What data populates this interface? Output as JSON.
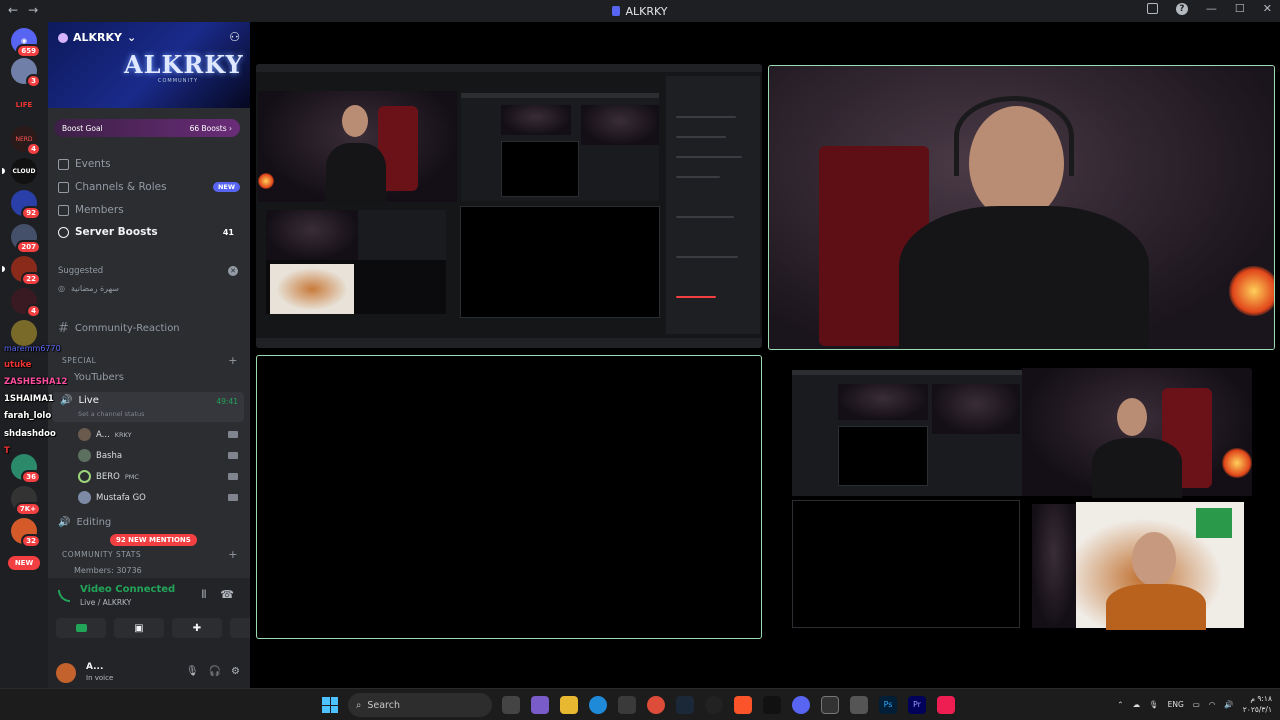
{
  "window": {
    "title": "ALKRKY"
  },
  "servers": [
    {
      "name": "discord-home",
      "badge": "659"
    },
    {
      "name": "server-2",
      "badge": "3"
    },
    {
      "name": "server-life",
      "label": "LIFE",
      "badge": ""
    },
    {
      "name": "server-4",
      "label": "NERD",
      "badge": "4"
    },
    {
      "name": "server-cloud",
      "label": "CLOUD",
      "badge": ""
    },
    {
      "name": "server-6",
      "badge": "92"
    },
    {
      "name": "server-7",
      "badge": "207"
    },
    {
      "name": "server-8",
      "badge": "22"
    },
    {
      "name": "server-9",
      "badge": "4"
    },
    {
      "name": "server-10",
      "badge": ""
    },
    {
      "name": "server-11",
      "badge": "36"
    },
    {
      "name": "server-12",
      "badge": "7K+"
    },
    {
      "name": "server-13",
      "badge": "32"
    }
  ],
  "new_label": "NEW",
  "server": {
    "name": "ALKRKY",
    "banner_logo": "ALKRKY",
    "banner_sub": "COMMUNITY",
    "boost_goal": "Boost Goal",
    "boost_count": "66 Boosts"
  },
  "menu": [
    {
      "label": "Events",
      "extra": ""
    },
    {
      "label": "Channels & Roles",
      "pill": "NEW"
    },
    {
      "label": "Members",
      "extra": ""
    },
    {
      "label": "Server Boosts",
      "count": "41"
    }
  ],
  "suggested": {
    "header": "Suggested",
    "item": "سهرة رمضانية"
  },
  "channels": {
    "community_reaction": "Community-Reaction",
    "cat_special": "SPECIAL",
    "youtubers": "YouTubers",
    "live": "Live",
    "live_time": "49:41",
    "live_status": "Set a channel status",
    "voice_users": [
      {
        "name": "A...",
        "tag": "KRKY"
      },
      {
        "name": "Basha",
        "tag": ""
      },
      {
        "name": "BERO",
        "tag": "PMC"
      },
      {
        "name": "Mustafa GO",
        "tag": ""
      }
    ],
    "editing": "Editing",
    "cat_stats": "COMMUNITY STATS",
    "members_stat": "Members: 30736"
  },
  "chat_overlay": [
    {
      "user": "maremm6770",
      "msg": ""
    },
    {
      "user": "utuke",
      "msg": ""
    },
    {
      "user": "ZASHESHA12",
      "msg": ""
    },
    {
      "user": "1SHAIMA1",
      "msg": ""
    },
    {
      "user": "farah_lolo",
      "msg": ""
    },
    {
      "user": "shdashdoo",
      "msg": ""
    },
    {
      "user": "T",
      "msg": ""
    }
  ],
  "mentions_pill": "92 NEW MENTIONS",
  "voice": {
    "status": "Video Connected",
    "channel": "Live / ALKRKY"
  },
  "user": {
    "name": "A...",
    "status": "In voice"
  },
  "taskbar": {
    "search_placeholder": "Search",
    "lang": "ENG",
    "time": "٩:١٨ م",
    "date": "٢٠٢٥/٣/١"
  },
  "colors": {
    "accent": "#5865f2",
    "green": "#23a559",
    "red": "#f23f42",
    "stream_border": "#9bdcb0"
  }
}
